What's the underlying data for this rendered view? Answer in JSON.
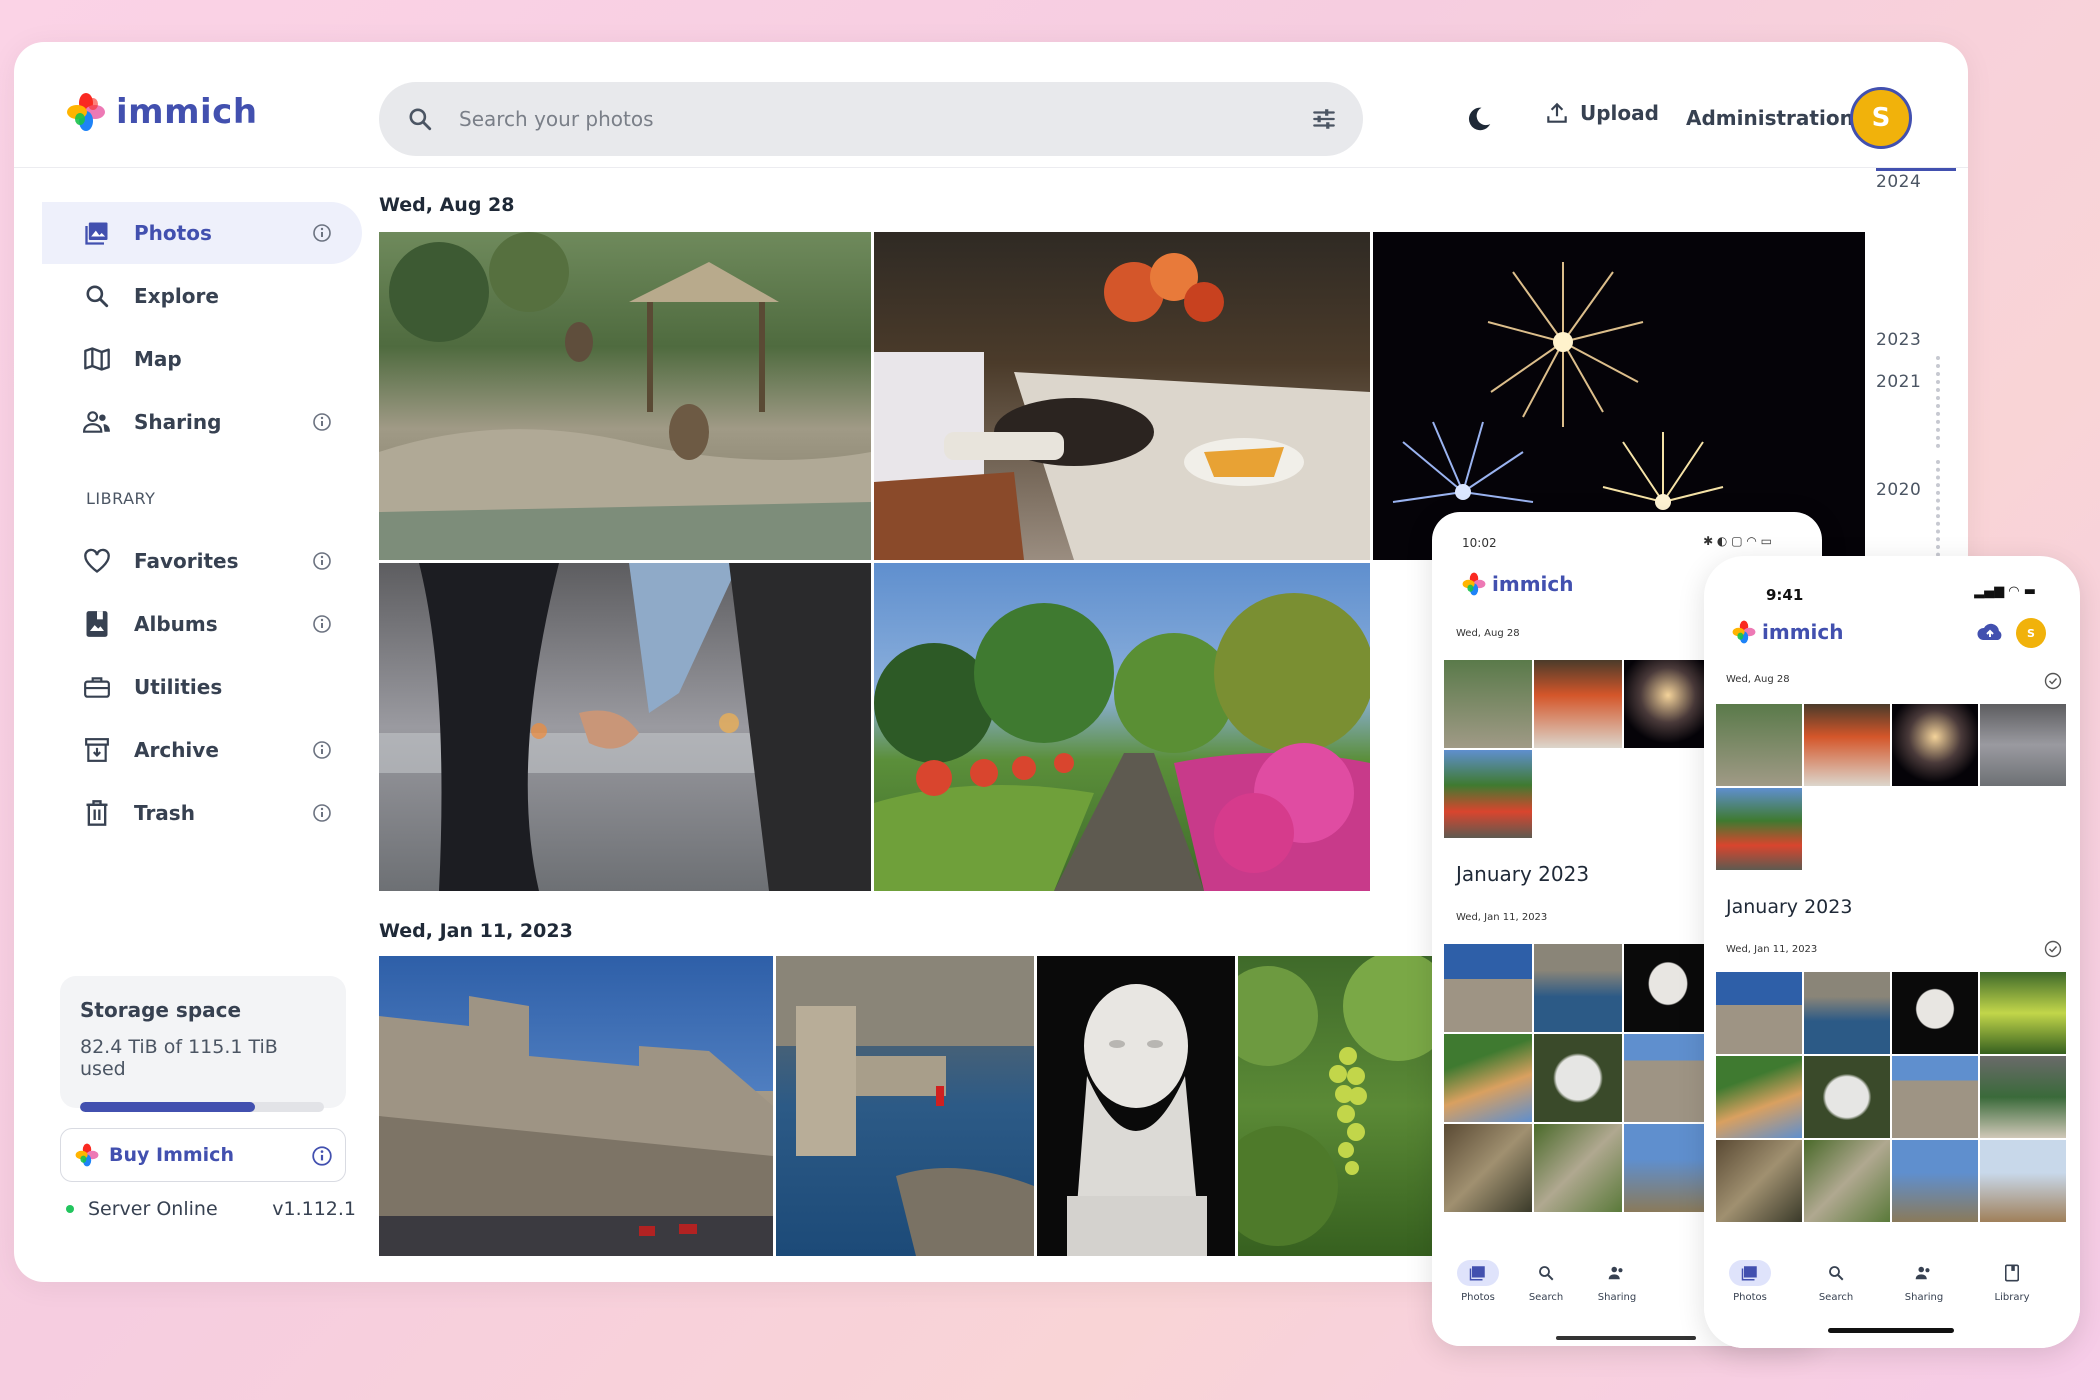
{
  "app": {
    "name": "immich",
    "search_placeholder": "Search your photos",
    "upload_label": "Upload",
    "admin_label": "Administration",
    "avatar_initial": "S"
  },
  "sidebar": {
    "items": [
      {
        "label": "Photos",
        "icon": "photos-icon"
      },
      {
        "label": "Explore",
        "icon": "search-icon"
      },
      {
        "label": "Map",
        "icon": "map-icon"
      },
      {
        "label": "Sharing",
        "icon": "people-icon"
      }
    ],
    "library_label": "LIBRARY",
    "library_items": [
      {
        "label": "Favorites",
        "icon": "heart-icon"
      },
      {
        "label": "Albums",
        "icon": "album-icon"
      },
      {
        "label": "Utilities",
        "icon": "toolbox-icon"
      },
      {
        "label": "Archive",
        "icon": "archive-icon"
      },
      {
        "label": "Trash",
        "icon": "trash-icon"
      }
    ]
  },
  "storage": {
    "title": "Storage space",
    "usage": "82.4 TiB of 115.1 TiB used",
    "fraction": 0.716
  },
  "buy_label": "Buy Immich",
  "server": {
    "status": "Server Online",
    "version": "v1.112.1"
  },
  "timeline": {
    "groups": [
      {
        "date": "Wed, Aug 28"
      },
      {
        "date": "Wed, Jan 11, 2023"
      }
    ],
    "years": [
      "2024",
      "2023",
      "2021",
      "2020"
    ]
  },
  "phone_android": {
    "status_time": "10:02",
    "app_name": "immich",
    "group1_date": "Wed, Aug 28",
    "month_heading": "January 2023",
    "group2_date": "Wed, Jan 11, 2023",
    "tabs": [
      "Photos",
      "Search",
      "Sharing"
    ]
  },
  "phone_ios": {
    "status_time": "9:41",
    "app_name": "immich",
    "group1_date": "Wed, Aug 28",
    "month_heading": "January 2023",
    "group2_date": "Wed, Jan 11, 2023",
    "tabs": [
      "Photos",
      "Search",
      "Sharing",
      "Library"
    ],
    "avatar_initial": "S"
  },
  "colors": {
    "brand": "#4250af",
    "avatar": "#f1b20b",
    "online": "#22c55e"
  }
}
